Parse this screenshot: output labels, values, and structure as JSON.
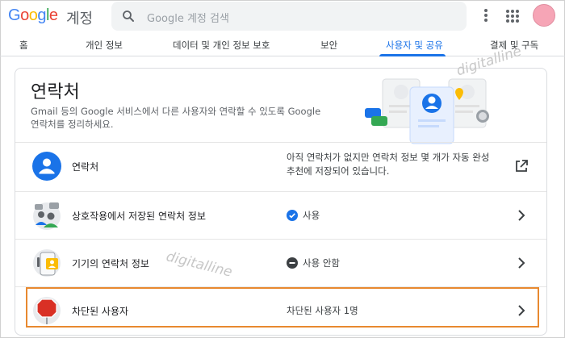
{
  "header": {
    "logo": {
      "g1": "G",
      "o1": "o",
      "o2": "o",
      "g2": "g",
      "l": "l",
      "e": "e"
    },
    "logo_suffix": "계정",
    "search_placeholder": "Google 계정 검색",
    "icons": [
      "search-icon",
      "more-vert-icon",
      "apps-grid-icon"
    ]
  },
  "tabs": [
    {
      "label": "홈",
      "active": false
    },
    {
      "label": "개인 정보",
      "active": false
    },
    {
      "label": "데이터 및 개인 정보 보호",
      "active": false
    },
    {
      "label": "보안",
      "active": false
    },
    {
      "label": "사용자 및 공유",
      "active": true
    },
    {
      "label": "결제 및 구독",
      "active": false
    }
  ],
  "card": {
    "title": "연락처",
    "description": "Gmail 등의 Google 서비스에서 다른 사용자와 연락할 수 있도록 Google 연락처를 정리하세요.",
    "rows": [
      {
        "label": "연락처",
        "value_line1": "아직 연락처가 없지만 연락처 정보 몇 개가 자동 완성",
        "value_line2": "추천에 저장되어 있습니다.",
        "action_icon": "open-in-new-icon"
      },
      {
        "label": "상호작용에서 저장된 연락처 정보",
        "value": "사용",
        "status_icon": "check-circle-icon",
        "action_icon": "chevron-right-icon"
      },
      {
        "label": "기기의 연락처 정보",
        "value": "사용 안함",
        "status_icon": "minus-circle-icon",
        "action_icon": "chevron-right-icon"
      },
      {
        "label": "차단된 사용자",
        "value": "차단된 사용자 1명",
        "action_icon": "chevron-right-icon"
      }
    ]
  },
  "watermark": "digitalline",
  "colors": {
    "accent": "#1a73e8",
    "highlight": "#e8892f",
    "avatar": "#f6a5b6",
    "stop": "#d93025"
  }
}
